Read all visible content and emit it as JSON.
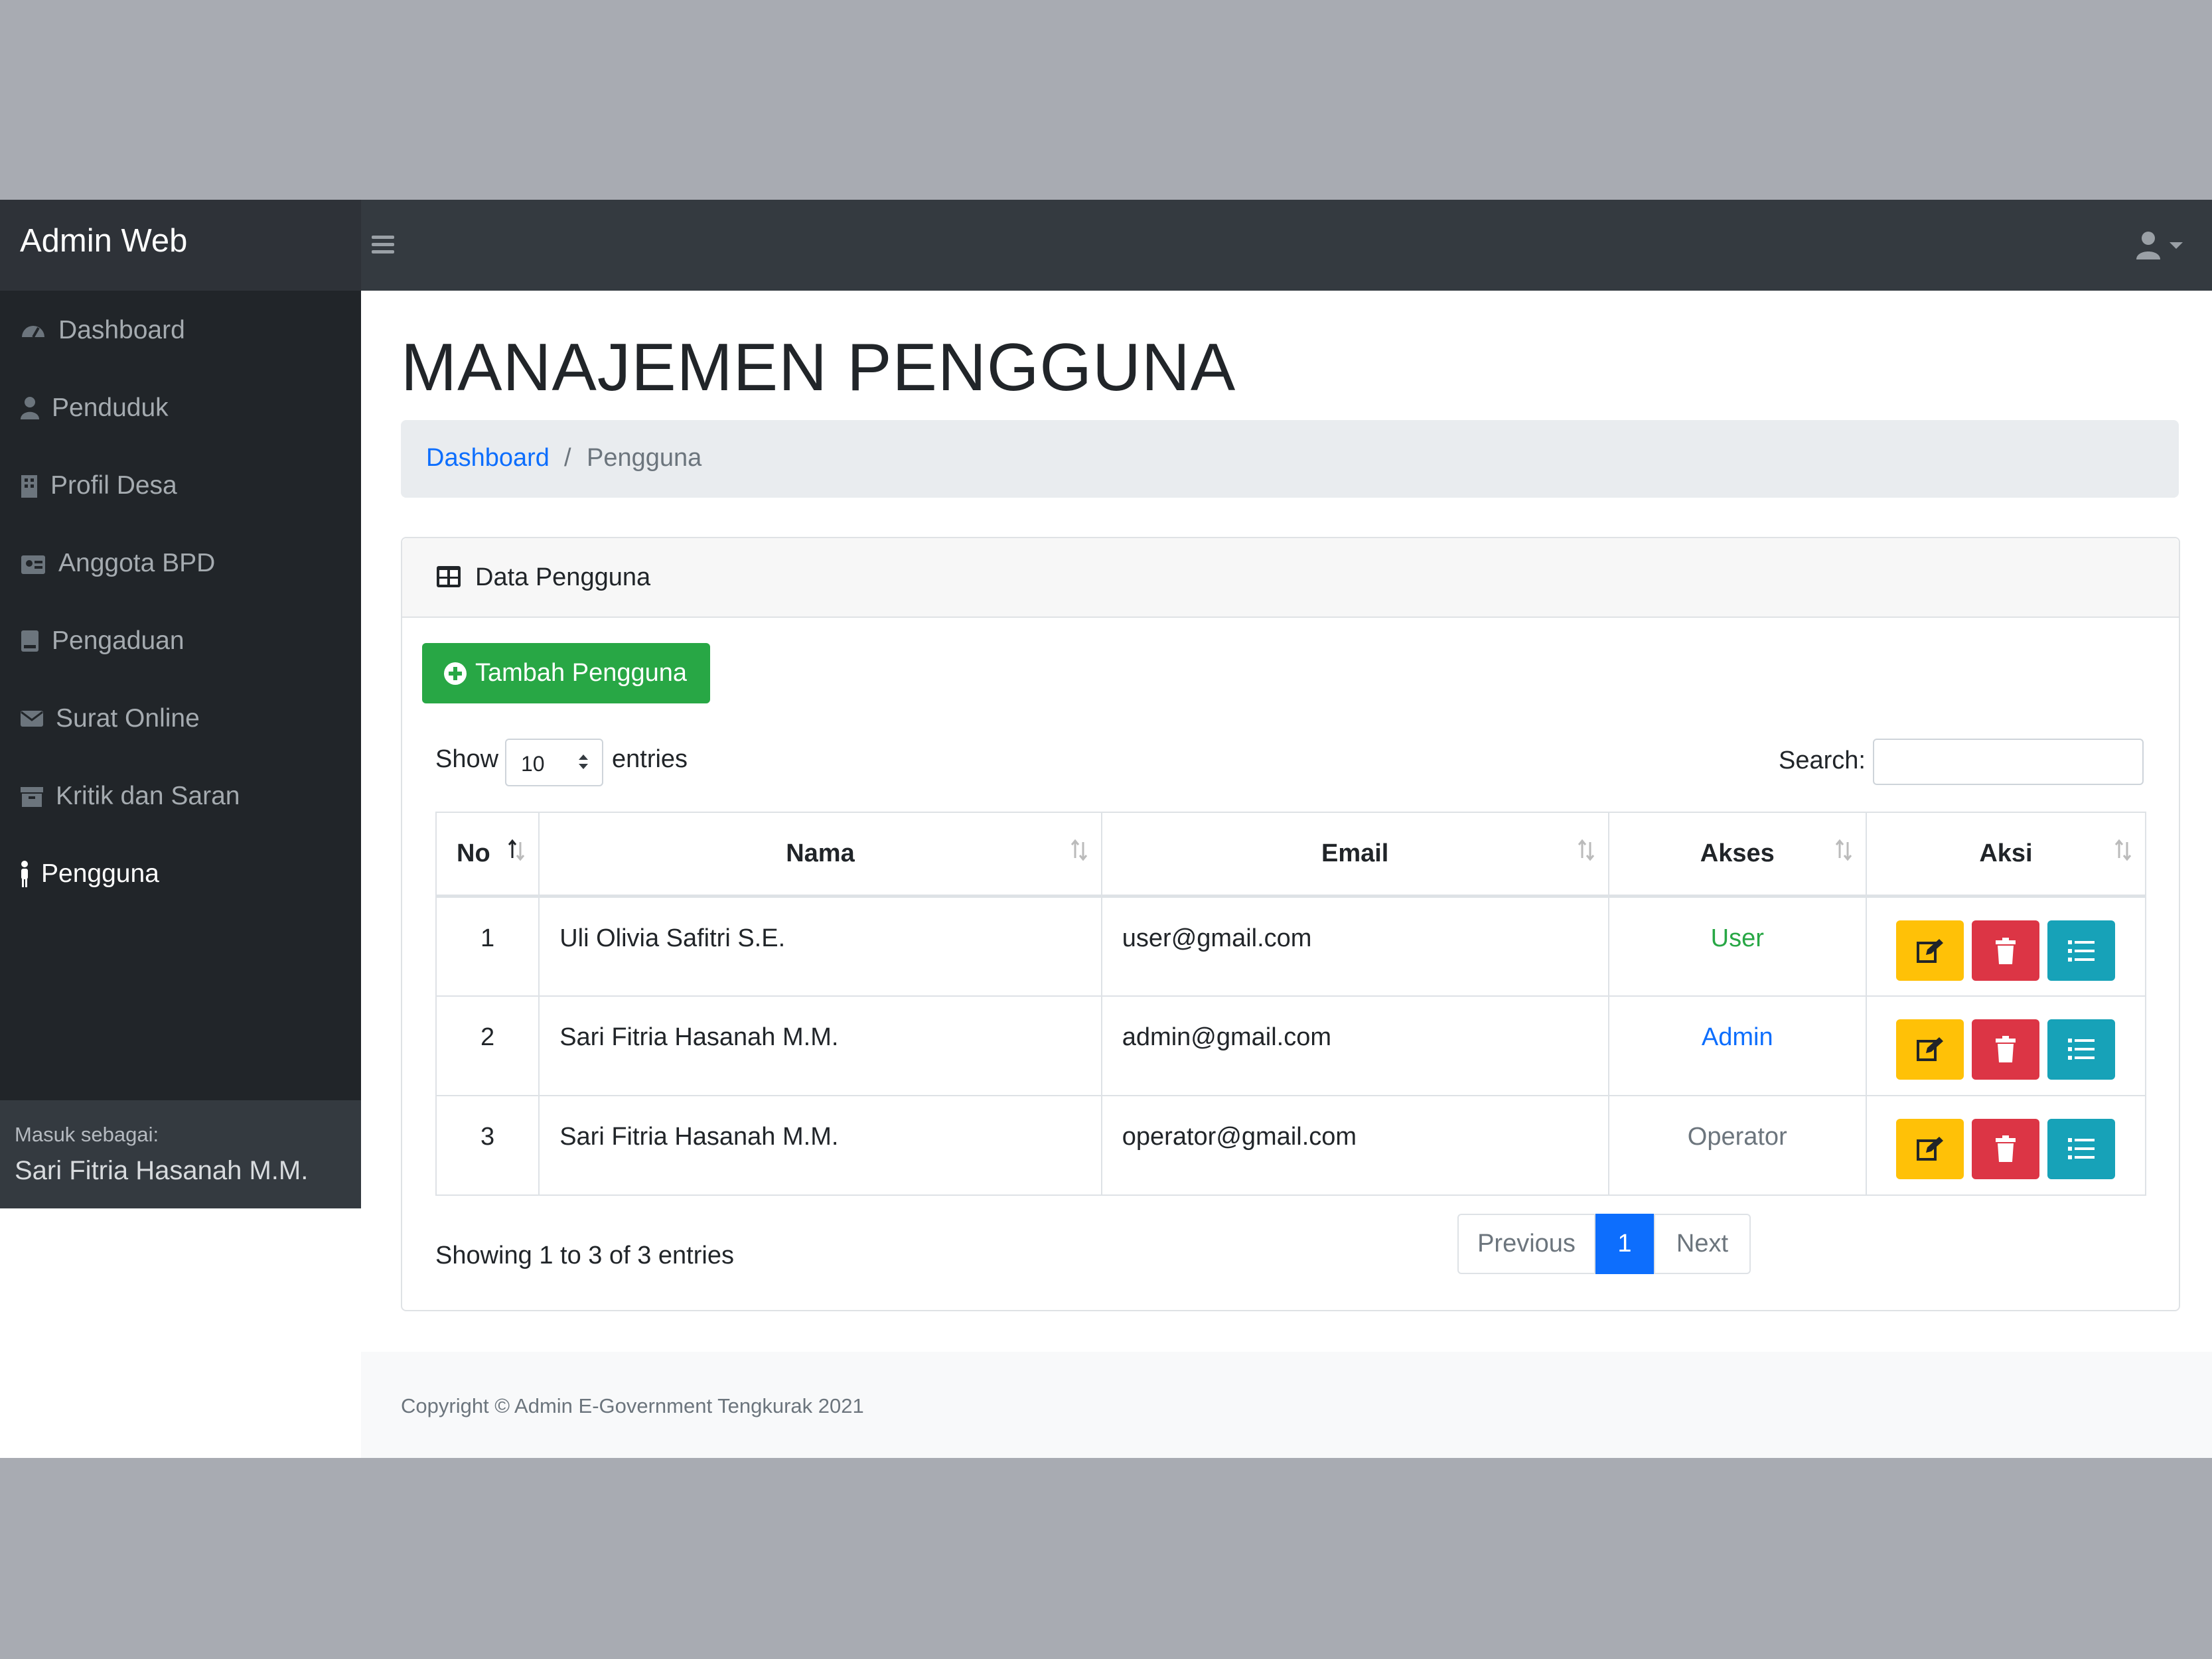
{
  "app": {
    "brand": "Admin Web"
  },
  "sidebar": {
    "items": [
      {
        "label": "Dashboard",
        "icon": "tachometer-icon"
      },
      {
        "label": "Penduduk",
        "icon": "user-icon"
      },
      {
        "label": "Profil Desa",
        "icon": "building-icon"
      },
      {
        "label": "Anggota BPD",
        "icon": "id-badge-icon"
      },
      {
        "label": "Pengaduan",
        "icon": "book-icon"
      },
      {
        "label": "Surat Online",
        "icon": "envelope-icon"
      },
      {
        "label": "Kritik dan Saran",
        "icon": "archive-icon"
      },
      {
        "label": "Pengguna",
        "icon": "male-icon",
        "active": true
      }
    ],
    "footer": {
      "label": "Masuk sebagai:",
      "name": "Sari Fitria Hasanah M.M."
    }
  },
  "page": {
    "title": "MANAJEMEN PENGGUNA"
  },
  "breadcrumb": {
    "home": "Dashboard",
    "separator": "/",
    "current": "Pengguna"
  },
  "card": {
    "title": "Data Pengguna",
    "add_button": "Tambah Pengguna",
    "show_label": "Show",
    "show_value": "10",
    "entries_label": "entries",
    "search_label": "Search:",
    "columns": [
      "No",
      "Nama",
      "Email",
      "Akses",
      "Aksi"
    ],
    "rows": [
      {
        "no": "1",
        "nama": "Uli Olivia Safitri S.E.",
        "email": "user@gmail.com",
        "akses": "User"
      },
      {
        "no": "2",
        "nama": "Sari Fitria Hasanah M.M.",
        "email": "admin@gmail.com",
        "akses": "Admin"
      },
      {
        "no": "3",
        "nama": "Sari Fitria Hasanah M.M.",
        "email": "operator@gmail.com",
        "akses": "Operator"
      }
    ],
    "showing": "Showing 1 to 3 of 3 entries",
    "pager": {
      "prev": "Previous",
      "page": "1",
      "next": "Next"
    }
  },
  "footer": {
    "text": "Copyright © Admin E-Government Tengkurak 2021"
  },
  "colors": {
    "accent": "#0d6efd",
    "success": "#28a745",
    "warning": "#ffc107",
    "danger": "#dc3545",
    "info": "#17a2b8",
    "nav": "#343a40",
    "sidebar": "#212529"
  }
}
